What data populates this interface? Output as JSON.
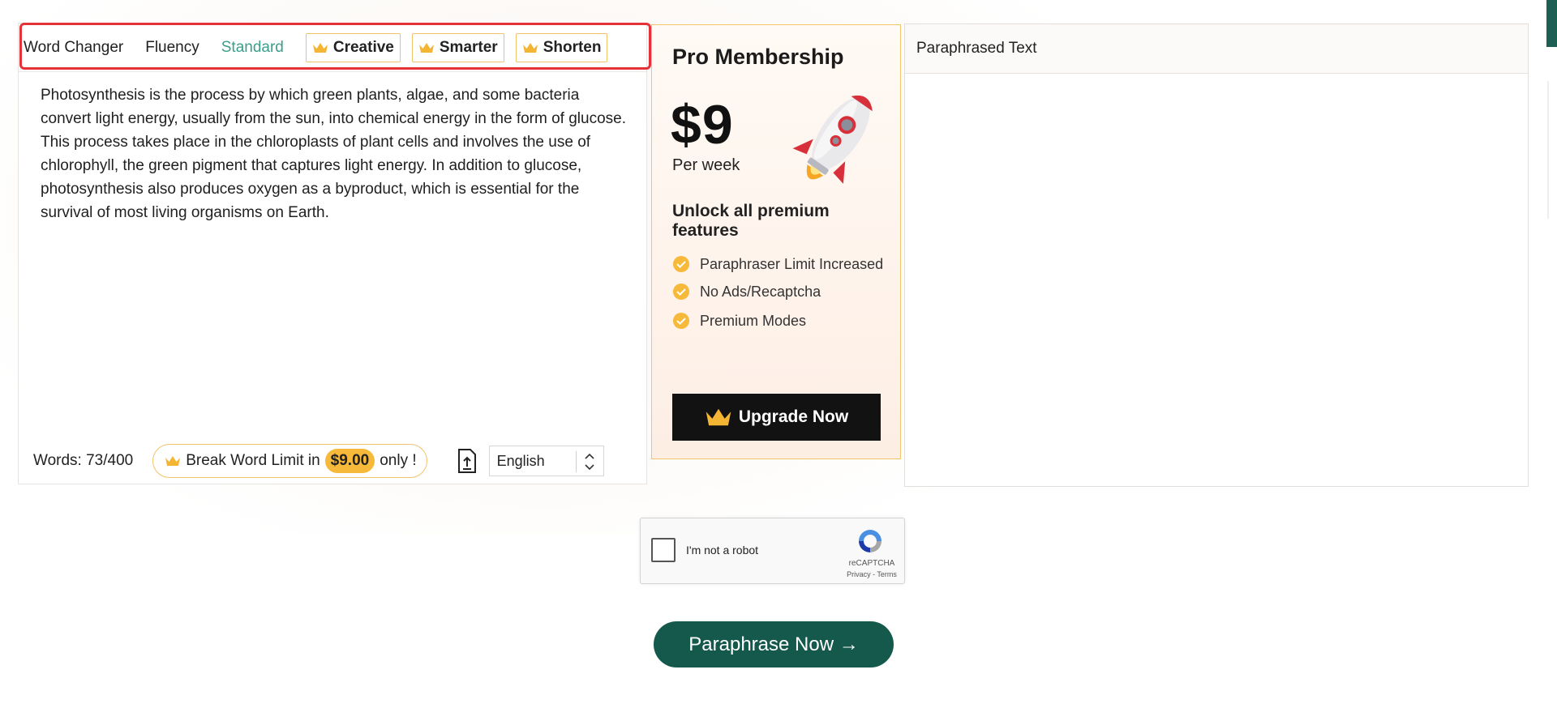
{
  "modes": {
    "plain": [
      "Word Changer",
      "Fluency",
      "Standard"
    ],
    "active": "Standard",
    "premium": [
      "Creative",
      "Smarter",
      "Shorten"
    ]
  },
  "editor": {
    "text": "Photosynthesis is the process by which green plants, algae, and some bacteria convert light energy, usually from the sun, into chemical energy in the form of glucose. This process takes place in the chloroplasts of plant cells and involves the use of chlorophyll, the green pigment that captures light energy. In addition to glucose, photosynthesis also produces oxygen as a byproduct, which is essential for the survival of most living organisms on Earth.",
    "word_count": "Words: 73/400",
    "break_limit_prefix": "Break Word Limit in",
    "break_limit_price": "$9.00",
    "break_limit_suffix": "only !",
    "language": "English"
  },
  "promo": {
    "title": "Pro Membership",
    "price": "$9",
    "period": "Per week",
    "unlock": "Unlock all premium features",
    "features": [
      "Paraphraser Limit Increased",
      "No Ads/Recaptcha",
      "Premium Modes"
    ],
    "upgrade_label": "Upgrade Now"
  },
  "output": {
    "header": "Paraphrased Text"
  },
  "captcha": {
    "label": "I'm not a robot",
    "brand": "reCAPTCHA",
    "links": "Privacy - Terms"
  },
  "action": {
    "paraphrase_label": "Paraphrase Now →"
  },
  "colors": {
    "accent_green": "#15594d",
    "active_mode": "#3a9e8b",
    "gold": "#f6b93a",
    "highlight_red": "#e53238"
  }
}
